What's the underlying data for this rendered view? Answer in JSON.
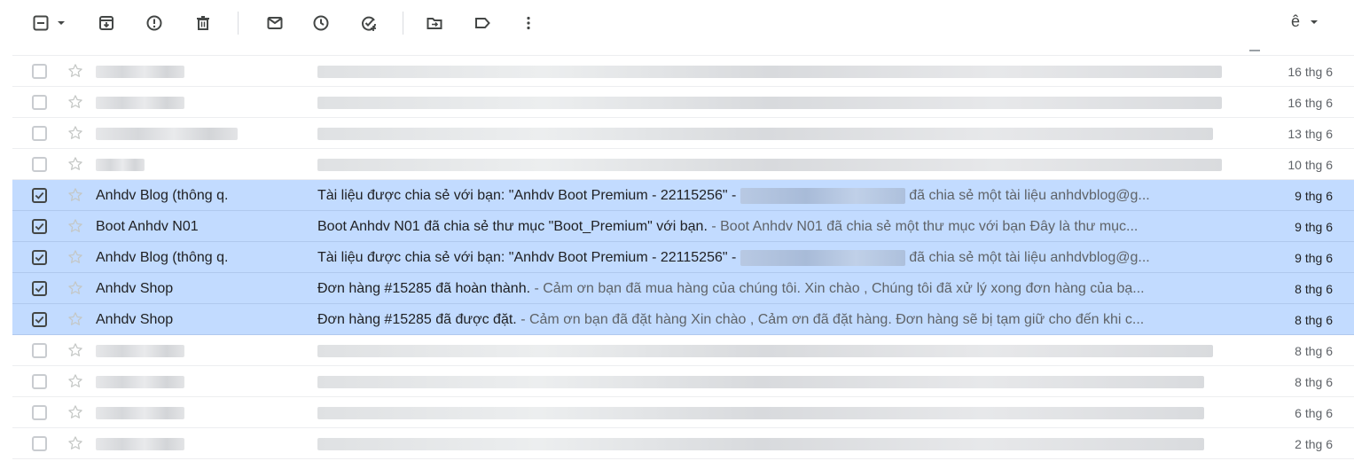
{
  "toolbar": {
    "icons": [
      "select-checkbox-icon",
      "archive-icon",
      "report-spam-icon",
      "delete-icon",
      "mark-unread-icon",
      "snooze-icon",
      "add-to-tasks-icon",
      "move-to-icon",
      "label-icon",
      "more-vert-icon"
    ],
    "input_tools_label": "ê"
  },
  "emails": [
    {
      "selected": false,
      "sender": "",
      "subject": "",
      "snippet": "",
      "date": "16 thg 6"
    },
    {
      "selected": false,
      "sender": "",
      "subject": "",
      "snippet": "",
      "date": "16 thg 6"
    },
    {
      "selected": false,
      "sender": "",
      "subject": "",
      "snippet": "",
      "date": "13 thg 6"
    },
    {
      "selected": false,
      "sender": "",
      "subject": "",
      "snippet": "",
      "date": "10 thg 6"
    },
    {
      "selected": true,
      "sender": "Anhdv Blog (thông q.",
      "subject": "Tài liệu được chia sẻ với bạn: \"Anhdv Boot Premium - 22115256\" - ",
      "snippet": " đã chia sẻ một tài liệu anhdvblog@g...",
      "date": "9 thg 6"
    },
    {
      "selected": true,
      "sender": "Boot Anhdv N01",
      "subject": "Boot Anhdv N01 đã chia sẻ thư mục \"Boot_Premium\" với bạn.",
      "snippet": " - Boot Anhdv N01 đã chia sẻ một thư mục với bạn Đây là thư mục...",
      "date": "9 thg 6"
    },
    {
      "selected": true,
      "sender": "Anhdv Blog (thông q.",
      "subject": "Tài liệu được chia sẻ với bạn: \"Anhdv Boot Premium - 22115256\" - ",
      "snippet": " đã chia sẻ một tài liệu anhdvblog@g...",
      "date": "9 thg 6"
    },
    {
      "selected": true,
      "sender": "Anhdv Shop",
      "subject": "Đơn hàng #15285 đã hoàn thành.",
      "snippet": " - Cảm ơn bạn đã mua hàng của chúng tôi. Xin chào , Chúng tôi đã xử lý xong đơn hàng của bạ...",
      "date": "8 thg 6"
    },
    {
      "selected": true,
      "sender": "Anhdv Shop",
      "subject": "Đơn hàng #15285 đã được đặt.",
      "snippet": " - Cảm ơn bạn đã đặt hàng Xin chào , Cảm ơn đã đặt hàng. Đơn hàng sẽ bị tạm giữ cho đến khi c...",
      "date": "8 thg 6"
    },
    {
      "selected": false,
      "sender": "",
      "subject": "",
      "snippet": "",
      "date": "8 thg 6"
    },
    {
      "selected": false,
      "sender": "",
      "subject": "",
      "snippet": "",
      "date": "8 thg 6"
    },
    {
      "selected": false,
      "sender": "",
      "subject": "",
      "snippet": "",
      "date": "6 thg 6"
    },
    {
      "selected": false,
      "sender": "",
      "subject": "",
      "snippet": "",
      "date": "2 thg 6"
    }
  ],
  "colors": {
    "selected_row": "#c2dbff",
    "row_border": "#edeef0",
    "icon": "#444746",
    "snippet": "#5f6368"
  }
}
